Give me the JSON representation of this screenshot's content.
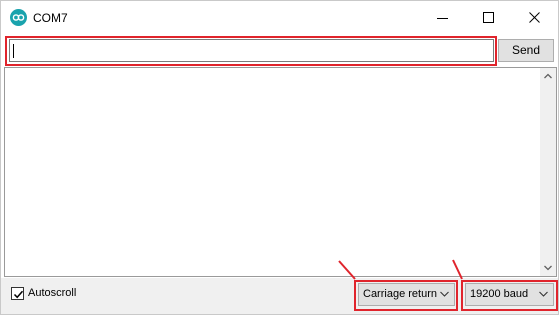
{
  "window": {
    "title": "COM7",
    "icon": "arduino-icon",
    "controls": [
      "minimize-icon",
      "maximize-icon",
      "close-icon"
    ]
  },
  "input": {
    "value": "",
    "placeholder": ""
  },
  "send_button": {
    "label": "Send"
  },
  "output": {
    "text": ""
  },
  "footer": {
    "autoscroll_label": "Autoscroll",
    "autoscroll_checked": true,
    "line_ending": {
      "selected": "Carriage return"
    },
    "baud_rate": {
      "selected": "19200 baud"
    }
  },
  "colors": {
    "highlight": "#e0242c",
    "icon": "#1aa3ad"
  }
}
